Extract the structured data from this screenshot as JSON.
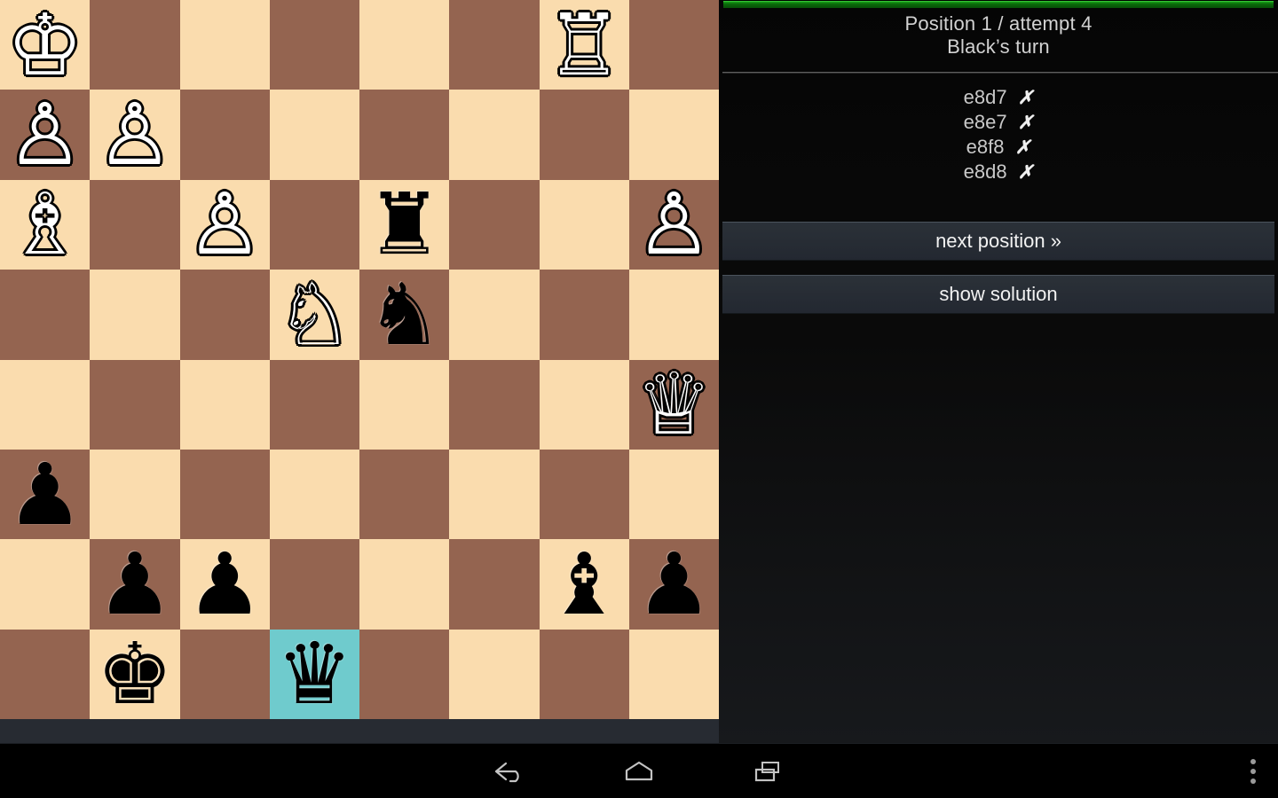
{
  "app": {
    "board": {
      "light_square_color": "#fadcae",
      "dark_square_color": "#946450",
      "highlight_color": "#6fcbcd",
      "highlighted_squares": [
        "d1"
      ],
      "files": [
        "a",
        "b",
        "c",
        "d",
        "e",
        "f",
        "g",
        "h"
      ],
      "ranks": [
        "8",
        "7",
        "6",
        "5",
        "4",
        "3",
        "2",
        "1"
      ],
      "pieces": [
        {
          "square": "a8",
          "piece": "white-king",
          "glyph": "♔",
          "color": "w"
        },
        {
          "square": "g8",
          "piece": "white-rook",
          "glyph": "♖",
          "color": "w"
        },
        {
          "square": "a7",
          "piece": "white-pawn",
          "glyph": "♙",
          "color": "w"
        },
        {
          "square": "b7",
          "piece": "white-pawn",
          "glyph": "♙",
          "color": "w"
        },
        {
          "square": "a6",
          "piece": "white-bishop",
          "glyph": "♗",
          "color": "w"
        },
        {
          "square": "c6",
          "piece": "white-pawn",
          "glyph": "♙",
          "color": "w"
        },
        {
          "square": "e6",
          "piece": "black-rook",
          "glyph": "♜",
          "color": "b"
        },
        {
          "square": "h6",
          "piece": "white-pawn",
          "glyph": "♙",
          "color": "w"
        },
        {
          "square": "d5",
          "piece": "white-knight",
          "glyph": "♘",
          "color": "w"
        },
        {
          "square": "e5",
          "piece": "black-knight",
          "glyph": "♞",
          "color": "b"
        },
        {
          "square": "h4",
          "piece": "white-queen",
          "glyph": "♕",
          "color": "w"
        },
        {
          "square": "a3",
          "piece": "black-pawn",
          "glyph": "♟",
          "color": "b"
        },
        {
          "square": "b2",
          "piece": "black-pawn",
          "glyph": "♟",
          "color": "b"
        },
        {
          "square": "c2",
          "piece": "black-pawn",
          "glyph": "♟",
          "color": "b"
        },
        {
          "square": "g2",
          "piece": "black-bishop",
          "glyph": "♝",
          "color": "b"
        },
        {
          "square": "h2",
          "piece": "black-pawn",
          "glyph": "♟",
          "color": "b"
        },
        {
          "square": "b1",
          "piece": "black-king",
          "glyph": "♚",
          "color": "b"
        },
        {
          "square": "d1",
          "piece": "black-queen",
          "glyph": "♛",
          "color": "b"
        }
      ]
    },
    "panel": {
      "progress": {
        "percent": 100,
        "color": "#0a6a0a"
      },
      "header": {
        "position_line": "Position 1 / attempt 4",
        "turn_line": "Black’s turn"
      },
      "attempts": [
        {
          "move": "e8d7",
          "mark": "✗"
        },
        {
          "move": "e8e7",
          "mark": "✗"
        },
        {
          "move": "e8f8",
          "mark": "✗"
        },
        {
          "move": "e8d8",
          "mark": "✗"
        }
      ],
      "buttons": {
        "next_position": "next position »",
        "show_solution": "show solution"
      }
    },
    "navbar": {
      "back": "back-icon",
      "home": "home-icon",
      "recents": "recents-icon",
      "overflow": "overflow-menu-icon"
    }
  }
}
